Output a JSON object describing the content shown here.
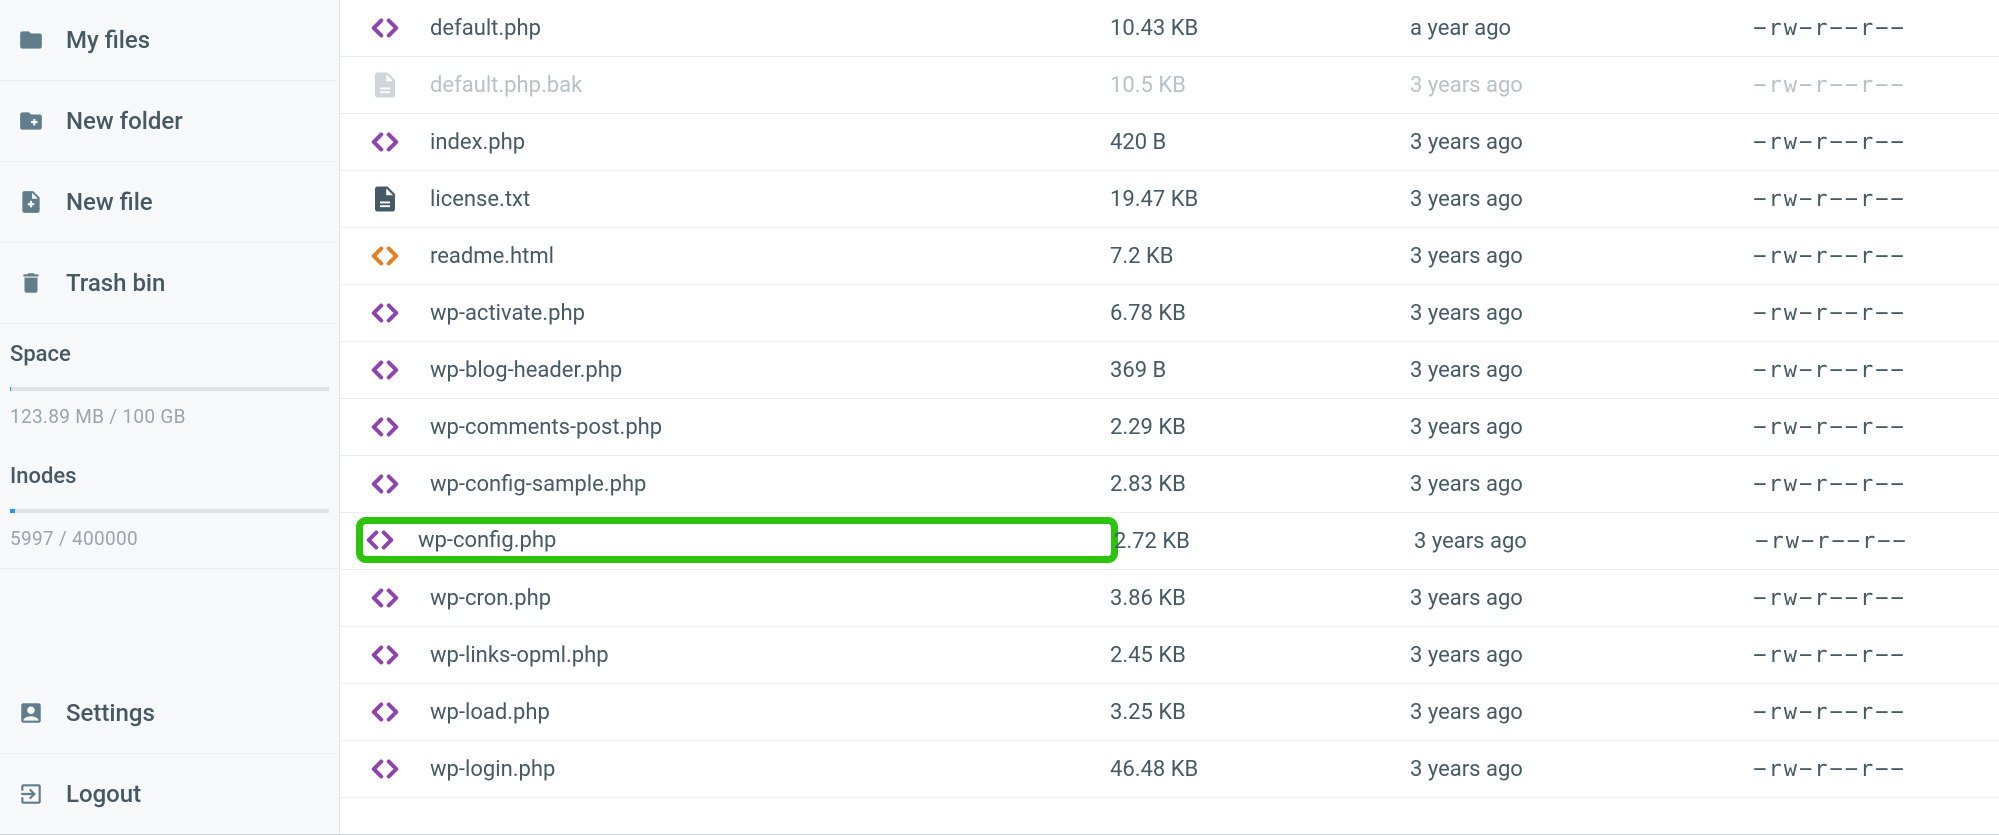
{
  "sidebar": {
    "items": [
      {
        "label": "My files",
        "icon": "folder-icon"
      },
      {
        "label": "New folder",
        "icon": "new-folder-icon"
      },
      {
        "label": "New file",
        "icon": "new-file-icon"
      },
      {
        "label": "Trash bin",
        "icon": "trash-icon"
      }
    ],
    "space_heading": "Space",
    "space_label": "123.89 MB / 100 GB",
    "space_pct": 0.12,
    "inodes_heading": "Inodes",
    "inodes_label": "5997 / 400000",
    "inodes_pct": 1.5,
    "settings_label": "Settings",
    "logout_label": "Logout"
  },
  "files": [
    {
      "name": "default.php",
      "size": "10.43 KB",
      "date": "a year ago",
      "perm": "−rw−r−−r−−",
      "icon": "code-purple",
      "dim": false,
      "hl": false
    },
    {
      "name": "default.php.bak",
      "size": "10.5 KB",
      "date": "3 years ago",
      "perm": "−rw−r−−r−−",
      "icon": "file-gray",
      "dim": true,
      "hl": false
    },
    {
      "name": "index.php",
      "size": "420 B",
      "date": "3 years ago",
      "perm": "−rw−r−−r−−",
      "icon": "code-purple",
      "dim": false,
      "hl": false
    },
    {
      "name": "license.txt",
      "size": "19.47 KB",
      "date": "3 years ago",
      "perm": "−rw−r−−r−−",
      "icon": "file-dark",
      "dim": false,
      "hl": false
    },
    {
      "name": "readme.html",
      "size": "7.2 KB",
      "date": "3 years ago",
      "perm": "−rw−r−−r−−",
      "icon": "code-orange",
      "dim": false,
      "hl": false
    },
    {
      "name": "wp-activate.php",
      "size": "6.78 KB",
      "date": "3 years ago",
      "perm": "−rw−r−−r−−",
      "icon": "code-purple",
      "dim": false,
      "hl": false
    },
    {
      "name": "wp-blog-header.php",
      "size": "369 B",
      "date": "3 years ago",
      "perm": "−rw−r−−r−−",
      "icon": "code-purple",
      "dim": false,
      "hl": false
    },
    {
      "name": "wp-comments-post.php",
      "size": "2.29 KB",
      "date": "3 years ago",
      "perm": "−rw−r−−r−−",
      "icon": "code-purple",
      "dim": false,
      "hl": false
    },
    {
      "name": "wp-config-sample.php",
      "size": "2.83 KB",
      "date": "3 years ago",
      "perm": "−rw−r−−r−−",
      "icon": "code-purple",
      "dim": false,
      "hl": false
    },
    {
      "name": "wp-config.php",
      "size": "2.72 KB",
      "date": "3 years ago",
      "perm": "−rw−r−−r−−",
      "icon": "code-purple",
      "dim": false,
      "hl": true
    },
    {
      "name": "wp-cron.php",
      "size": "3.86 KB",
      "date": "3 years ago",
      "perm": "−rw−r−−r−−",
      "icon": "code-purple",
      "dim": false,
      "hl": false
    },
    {
      "name": "wp-links-opml.php",
      "size": "2.45 KB",
      "date": "3 years ago",
      "perm": "−rw−r−−r−−",
      "icon": "code-purple",
      "dim": false,
      "hl": false
    },
    {
      "name": "wp-load.php",
      "size": "3.25 KB",
      "date": "3 years ago",
      "perm": "−rw−r−−r−−",
      "icon": "code-purple",
      "dim": false,
      "hl": false
    },
    {
      "name": "wp-login.php",
      "size": "46.48 KB",
      "date": "3 years ago",
      "perm": "−rw−r−−r−−",
      "icon": "code-purple",
      "dim": false,
      "hl": false
    }
  ],
  "icon_colors": {
    "code-purple": "#8e44ad",
    "code-orange": "#e67e22",
    "file-gray": "#cfd5da",
    "file-dark": "#455a64"
  }
}
